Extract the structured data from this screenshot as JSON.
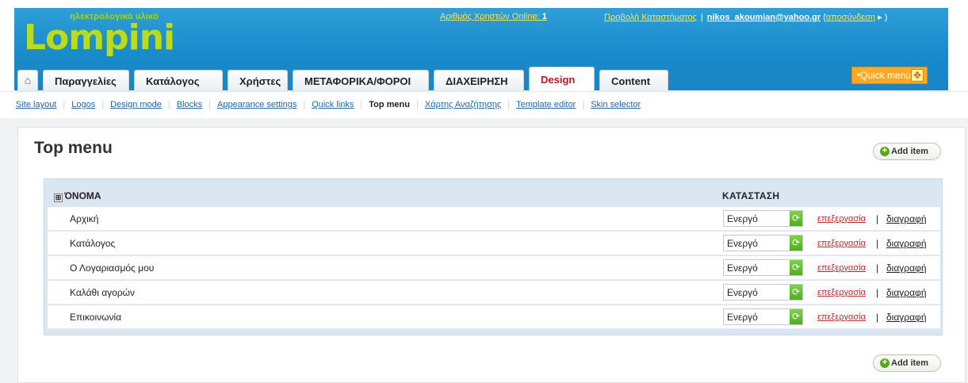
{
  "header": {
    "logo_tagline": "ηλεκτρολογικό υλικό",
    "logo_text": "Lompini",
    "online_label": "Αριθμός Χρηστών Online:",
    "online_count": "1",
    "view_store": "Προβολή Καταστήματος",
    "user_email": "nikos_akoumian@yahoo.gr",
    "logout": "αποσύνδεση",
    "quick_menu": "Quick menu"
  },
  "tabs": [
    {
      "label": "Παραγγελίες"
    },
    {
      "label": "Κατάλογος"
    },
    {
      "label": "Χρήστες"
    },
    {
      "label": "ΜΕΤΑΦΟΡΙΚΑ/ΦΟΡΟΙ"
    },
    {
      "label": "ΔΙΑΧΕΙΡΗΣΗ"
    },
    {
      "label": "Design"
    },
    {
      "label": "Content"
    }
  ],
  "subnav": [
    {
      "label": "Site layout"
    },
    {
      "label": "Logos"
    },
    {
      "label": "Design mode"
    },
    {
      "label": "Blocks"
    },
    {
      "label": "Appearance settings"
    },
    {
      "label": "Quick links"
    },
    {
      "label": "Top menu"
    },
    {
      "label": "Χάρτης Αναζήτησης"
    },
    {
      "label": "Template editor"
    },
    {
      "label": "Skin selector"
    }
  ],
  "page": {
    "title": "Top menu",
    "add_item": "Add item"
  },
  "table": {
    "col_name": "ΌΝΟΜΑ",
    "col_status": "ΚΑΤΑΣΤΑΣΗ",
    "edit_label": "επεξεργασία",
    "delete_label": "διαγραφή",
    "rows": [
      {
        "name": "Αρχική",
        "status": "Ενεργό"
      },
      {
        "name": "Κατάλογος",
        "status": "Ενεργό"
      },
      {
        "name": "Ο Λογαριασμός μου",
        "status": "Ενεργό"
      },
      {
        "name": "Καλάθι αγορών",
        "status": "Ενεργό"
      },
      {
        "name": "Επικοινωνία",
        "status": "Ενεργό"
      }
    ]
  }
}
